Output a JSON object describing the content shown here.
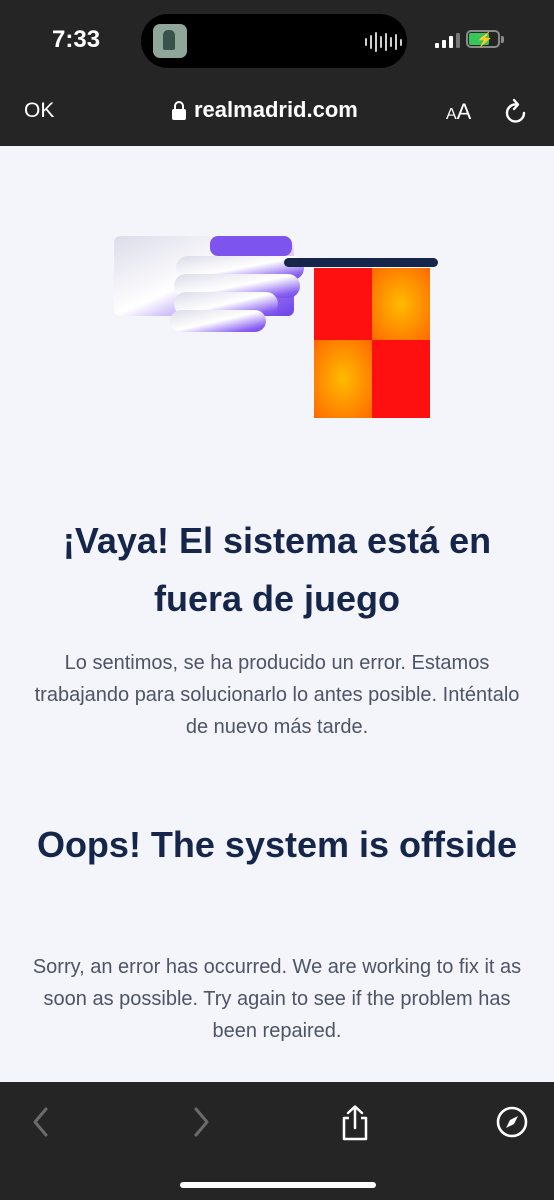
{
  "status_bar": {
    "time": "7:33",
    "icons": [
      "music-app-avatar-icon",
      "audio-waveform-icon",
      "cellular-signal-icon",
      "battery-charging-icon"
    ]
  },
  "browser": {
    "done_label": "OK",
    "url": "realmadrid.com",
    "text_size_label_small": "A",
    "text_size_label_large": "A",
    "icons": [
      "lock-icon",
      "reload-icon"
    ]
  },
  "error_page": {
    "illustration": "referee-hand-holding-offside-flag",
    "flag_colors": [
      "#ff0f0f",
      "#ffbb00"
    ],
    "accent_color": "#15264a",
    "spanish": {
      "heading": "¡Vaya! El sistema está en fuera de juego",
      "message": "Lo sentimos, se ha producido un error. Estamos trabajando para solucionarlo lo antes posible. Inténtalo de nuevo más tarde."
    },
    "english": {
      "heading": "Oops! The system is offside",
      "message": "Sorry, an error has occurred. We are working to fix it as soon as possible. Try again to see if the problem has been repaired."
    }
  },
  "toolbar": {
    "icons": [
      "back-icon",
      "forward-icon",
      "share-icon",
      "compass-icon"
    ]
  }
}
